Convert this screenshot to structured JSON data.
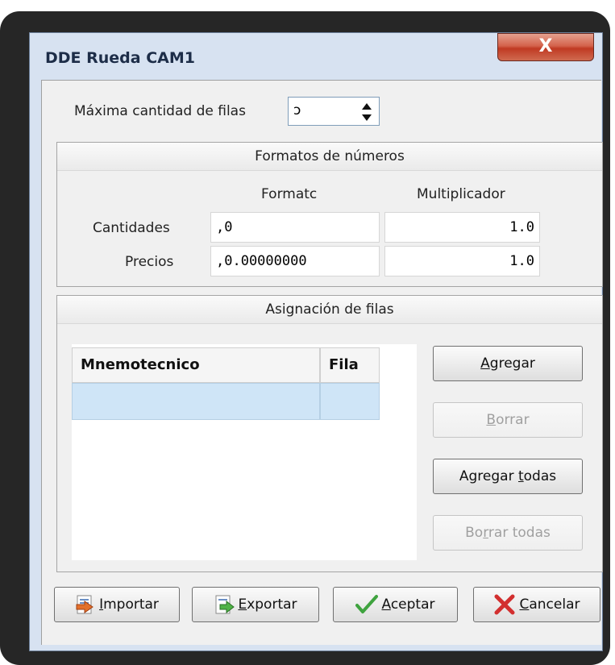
{
  "window": {
    "title": "DDE Rueda CAM1",
    "close_label": "X"
  },
  "max_rows": {
    "label": "Máxima cantidad de filas",
    "value": "ɔ"
  },
  "formats": {
    "header": "Formatos de números",
    "col_format": "Formatc",
    "col_multiplier": "Multiplicador",
    "rows": [
      {
        "label": "Cantidades",
        "format": ",0",
        "multiplier": "1.0"
      },
      {
        "label": "Precios",
        "format": ",0.00000000",
        "multiplier": "1.0"
      }
    ]
  },
  "assignment": {
    "header": "Asignación de filas",
    "columns": [
      "Mnemotecnico",
      "Fila"
    ],
    "buttons": {
      "add": {
        "pre": "",
        "key": "A",
        "post": "gregar"
      },
      "delete": {
        "pre": "",
        "key": "B",
        "post": "orrar"
      },
      "add_all": {
        "pre": "Agregar ",
        "key": "t",
        "post": "odas"
      },
      "delete_all": {
        "pre": "Bo",
        "key": "r",
        "post": "rar todas"
      }
    }
  },
  "footer": {
    "import": {
      "key": "I",
      "post": "mportar"
    },
    "export": {
      "key": "E",
      "post": "xportar"
    },
    "accept": {
      "key": "A",
      "post": "ceptar"
    },
    "cancel": {
      "key": "C",
      "post": "ancelar"
    }
  },
  "colors": {
    "accept_check": "#3fa33f",
    "cancel_x": "#d22f2f"
  }
}
